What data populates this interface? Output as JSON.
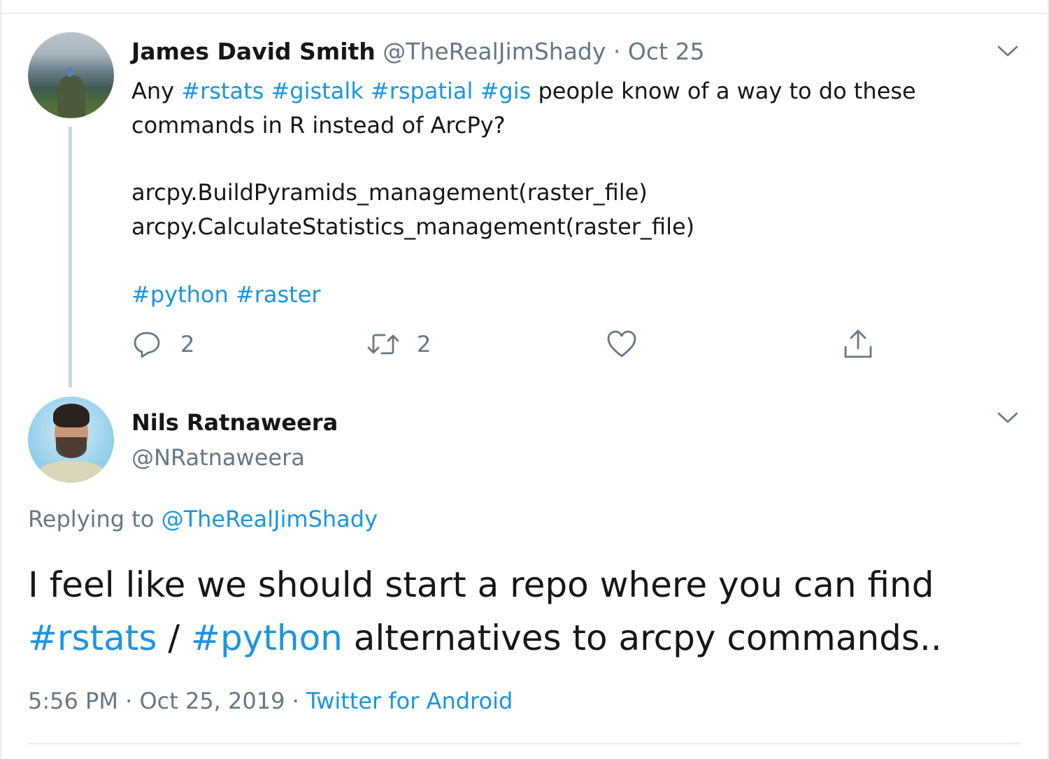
{
  "tweet1": {
    "author_name": "James David Smith",
    "handle": "@TheRealJimShady",
    "separator": "·",
    "date": "Oct 25",
    "text_prefix": "Any ",
    "hashtags_line1": [
      "#rstats",
      "#gistalk",
      "#rspatial",
      "#gis"
    ],
    "text_line1_rest": " people know of a way to do these",
    "text_line2": "commands in R instead of ArcPy?",
    "code_line1": "arcpy.BuildPyramids_management(raster_file)",
    "code_line2": "arcpy.CalculateStatistics_management(raster_file)",
    "hashtags_footer": [
      "#python",
      "#raster"
    ],
    "reply_count": "2",
    "retweet_count": "2"
  },
  "tweet2": {
    "author_name": "Nils Ratnaweera",
    "handle": "@NRatnaweera",
    "replying_label": "Replying to ",
    "replying_to": "@TheRealJimShady",
    "body_line1": "I feel like we should start a repo where you can find",
    "body_tag1": "#rstats",
    "body_slash": " / ",
    "body_tag2": "#python",
    "body_line2_rest": " alternatives to arcpy commands..",
    "time": "5:56 PM",
    "meta_separator": "·",
    "date": "Oct 25, 2019",
    "source": "Twitter for Android"
  },
  "icons": {
    "reply": "reply-icon",
    "retweet": "retweet-icon",
    "like": "heart-icon",
    "share": "share-icon",
    "more": "chevron-down-icon"
  },
  "colors": {
    "link": "#1b95e0",
    "muted": "#657786",
    "text": "#14171a",
    "divider": "#e6ecf0"
  }
}
